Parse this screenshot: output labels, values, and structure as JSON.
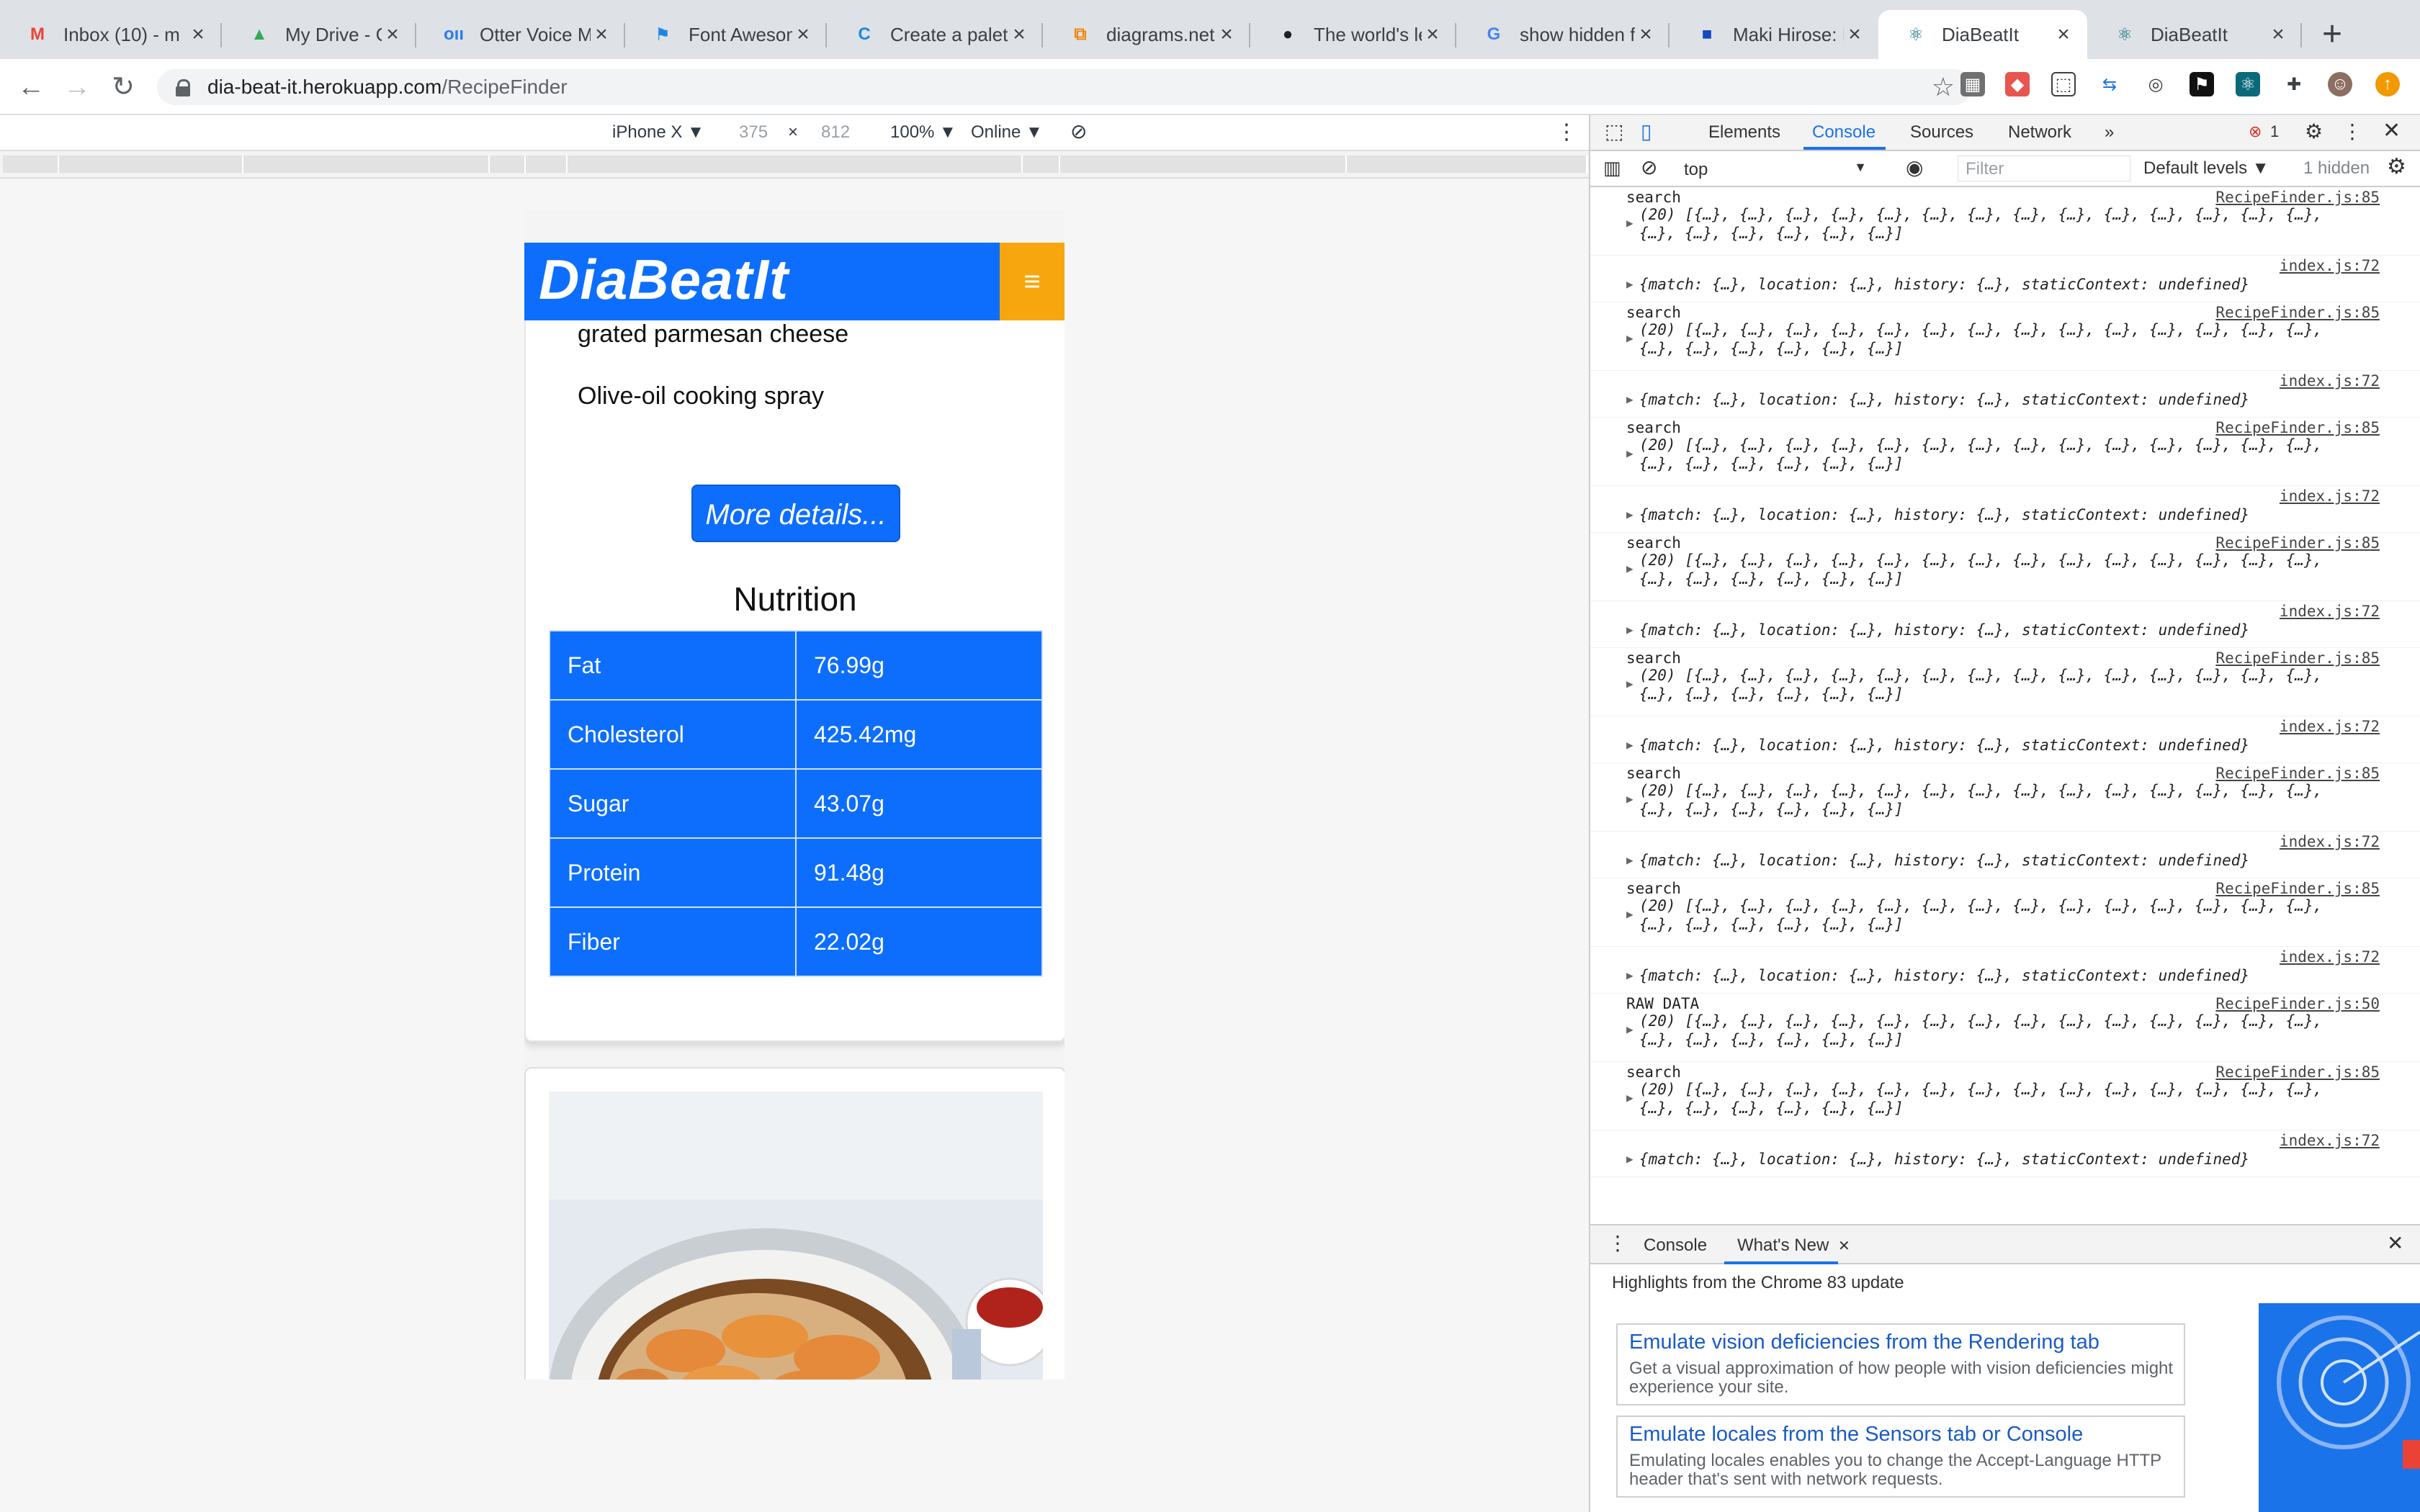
{
  "tabs": [
    {
      "title": "Inbox (10) - m",
      "icon": "gmail-icon",
      "fav_glyph": "M",
      "fav_color": "#ea4335"
    },
    {
      "title": "My Drive - Go",
      "icon": "drive-icon",
      "fav_glyph": "▲",
      "fav_color": "#34a853"
    },
    {
      "title": "Otter Voice M",
      "icon": "otter-icon",
      "fav_glyph": "oıı",
      "fav_color": "#2b7de9"
    },
    {
      "title": "Font Awesome",
      "icon": "font-awesome-flag-icon",
      "fav_glyph": "⚑",
      "fav_color": "#1c88e5"
    },
    {
      "title": "Create a palet",
      "icon": "coolors-icon",
      "fav_glyph": "C",
      "fav_color": "#1c88e5"
    },
    {
      "title": "diagrams.net",
      "icon": "drawio-icon",
      "fav_glyph": "⧉",
      "fav_color": "#f08705"
    },
    {
      "title": "The world's le",
      "icon": "github-icon",
      "fav_glyph": "●",
      "fav_color": "#202124"
    },
    {
      "title": "show hidden f",
      "icon": "google-icon",
      "fav_glyph": "G",
      "fav_color": "#4285f4"
    },
    {
      "title": "Maki Hirose: L",
      "icon": "doc-icon",
      "fav_glyph": "■",
      "fav_color": "#1549c2"
    },
    {
      "title": "DiaBeatIt",
      "icon": "react-icon",
      "fav_glyph": "⚛",
      "fav_color": "#0b6a7a",
      "active": true
    },
    {
      "title": "DiaBeatIt",
      "icon": "react-icon",
      "fav_glyph": "⚛",
      "fav_color": "#0b6a7a"
    }
  ],
  "omnibox": {
    "host": "dia-beat-it.herokuapp.com",
    "path": "/RecipeFinder"
  },
  "device_toolbar": {
    "device": "iPhone X ▼",
    "width": "375",
    "times": "×",
    "height": "812",
    "zoom": "100% ▼",
    "network": "Online ▼"
  },
  "app": {
    "title": "DiaBeatIt",
    "menu_glyph": "≡",
    "ingredients": [
      "grated parmesan cheese",
      "Olive-oil cooking spray"
    ],
    "more_details": "More details...",
    "nutrition_title": "Nutrition",
    "nutrition": [
      {
        "name": "Fat",
        "value": "76.99g"
      },
      {
        "name": "Cholesterol",
        "value": "425.42mg"
      },
      {
        "name": "Sugar",
        "value": "43.07g"
      },
      {
        "name": "Protein",
        "value": "91.48g"
      },
      {
        "name": "Fiber",
        "value": "22.02g"
      }
    ]
  },
  "devtools": {
    "tabs": [
      "Elements",
      "Console",
      "Sources",
      "Network",
      "»"
    ],
    "active_tab": "Console",
    "error_count": "1",
    "context": "top",
    "filter_placeholder": "Filter",
    "levels": "Default levels ▼",
    "hidden": "1 hidden",
    "messages": [
      {
        "label": "search",
        "source": "RecipeFinder.js:85",
        "kind": "array"
      },
      {
        "label": "",
        "source": "index.js:72",
        "kind": "object"
      },
      {
        "label": "search",
        "source": "RecipeFinder.js:85",
        "kind": "array"
      },
      {
        "label": "",
        "source": "index.js:72",
        "kind": "object"
      },
      {
        "label": "search",
        "source": "RecipeFinder.js:85",
        "kind": "array"
      },
      {
        "label": "",
        "source": "index.js:72",
        "kind": "object"
      },
      {
        "label": "search",
        "source": "RecipeFinder.js:85",
        "kind": "array"
      },
      {
        "label": "",
        "source": "index.js:72",
        "kind": "object"
      },
      {
        "label": "search",
        "source": "RecipeFinder.js:85",
        "kind": "array"
      },
      {
        "label": "",
        "source": "index.js:72",
        "kind": "object"
      },
      {
        "label": "search",
        "source": "RecipeFinder.js:85",
        "kind": "array"
      },
      {
        "label": "",
        "source": "index.js:72",
        "kind": "object"
      },
      {
        "label": "search",
        "source": "RecipeFinder.js:85",
        "kind": "array"
      },
      {
        "label": "",
        "source": "index.js:72",
        "kind": "object"
      },
      {
        "label": "RAW DATA",
        "source": "RecipeFinder.js:50",
        "kind": "array"
      },
      {
        "label": "search",
        "source": "RecipeFinder.js:85",
        "kind": "array"
      },
      {
        "label": "",
        "source": "index.js:72",
        "kind": "object"
      }
    ],
    "array_line1": "(20) [{…}, {…}, {…}, {…}, {…}, {…}, {…}, {…}, {…}, {…}, {…}, {…}, {…}, {…},",
    "array_line2": "{…}, {…}, {…}, {…}, {…}, {…}]",
    "object_line": "{match: {…}, location: {…}, history: {…}, staticContext: undefined}",
    "prompt": "›",
    "drawer_tabs": [
      "Console",
      "What's New"
    ],
    "drawer_active": "What's New",
    "highlights": "Highlights from the Chrome 83 update",
    "whats_new": [
      {
        "title": "Emulate vision deficiencies from the Rendering tab",
        "desc": "Get a visual approximation of how people with vision deficiencies might experience your site."
      },
      {
        "title": "Emulate locales from the Sensors tab or Console",
        "desc": "Emulating locales enables you to change the Accept-Language HTTP header that's sent with network requests."
      }
    ]
  },
  "colors": {
    "app_blue": "#0d6efd",
    "menu_orange": "#f7a70d",
    "devtools_accent": "#1a73e8"
  }
}
